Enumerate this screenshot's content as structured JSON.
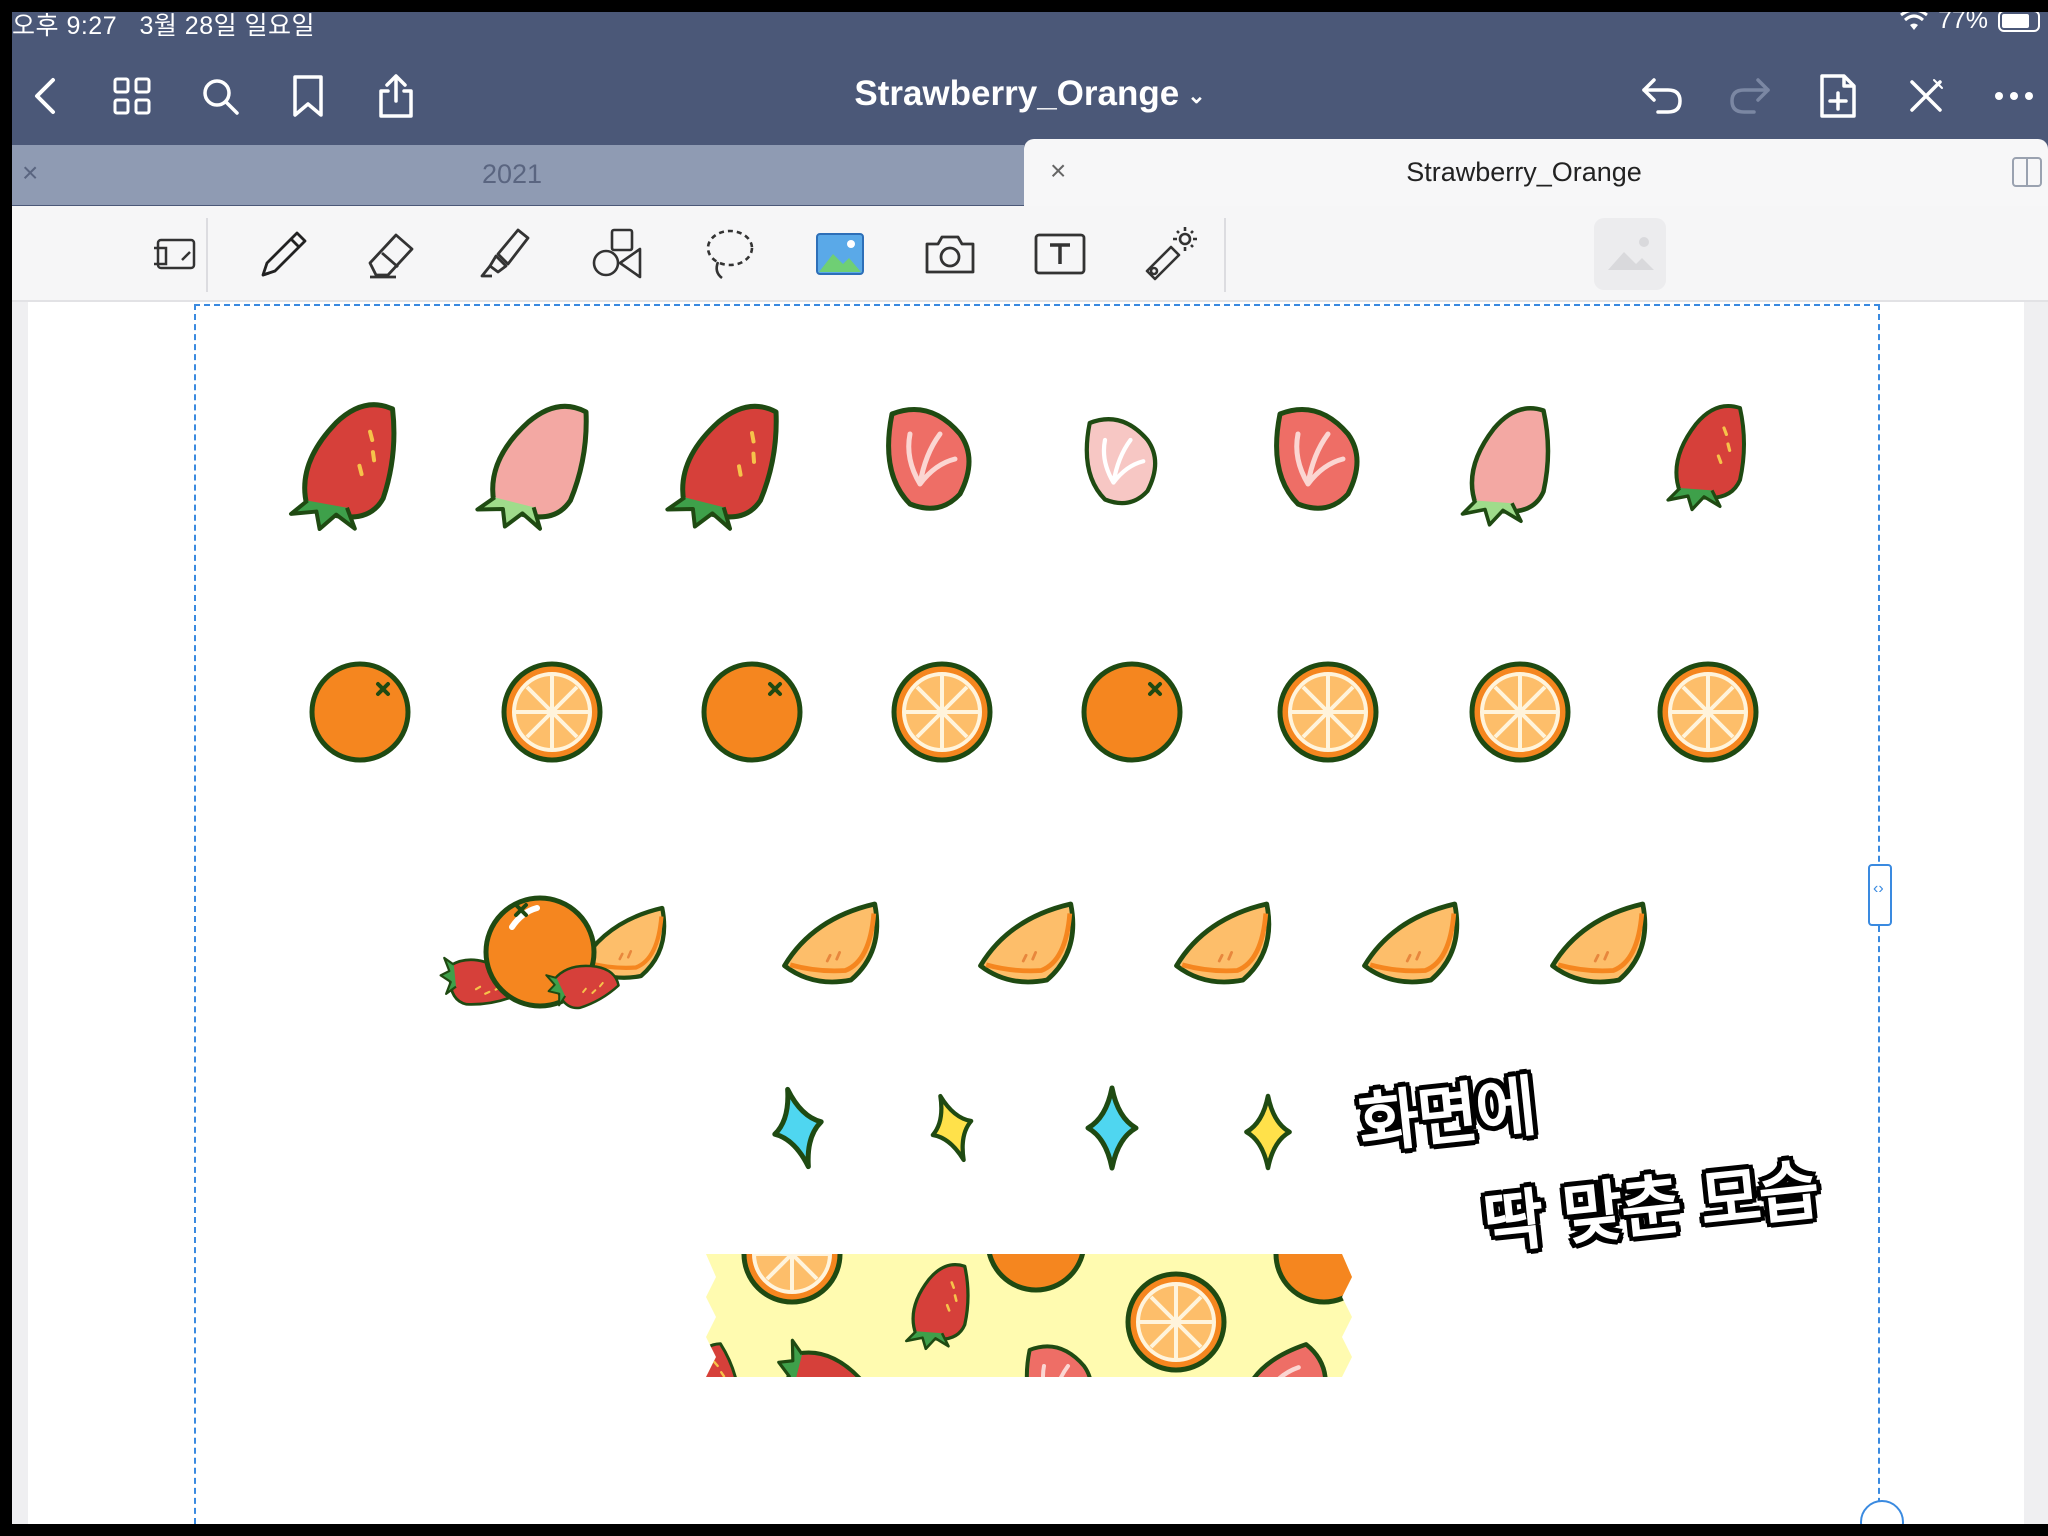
{
  "status_bar": {
    "time": "오후 9:27",
    "date": "3월 28일 일요일",
    "battery_percent": "77%",
    "wifi_icon": "wifi-icon",
    "battery_level": 0.77
  },
  "nav": {
    "title": "Strawberry_Orange",
    "title_chevron": "⌄",
    "left_icons": [
      "back-icon",
      "grid-icon",
      "search-icon",
      "bookmark-icon",
      "share-icon"
    ],
    "right_icons": [
      "undo-icon",
      "redo-icon",
      "add-page-icon",
      "close-tools-icon",
      "more-icon"
    ]
  },
  "tabs": [
    {
      "label": "2021",
      "close": "×",
      "active": false
    },
    {
      "label": "Strawberry_Orange",
      "close": "×",
      "active": true
    }
  ],
  "toolbar": {
    "tools": [
      "read-only-icon",
      "pen-icon",
      "eraser-icon",
      "highlighter-icon",
      "shapes-icon",
      "lasso-icon",
      "image-icon",
      "camera-icon",
      "text-icon",
      "laser-pointer-icon"
    ]
  },
  "canvas": {
    "handwriting_line1": "화면에",
    "handwriting_line2": "딱 맞춘 모습",
    "sticker_rows": [
      "strawberries",
      "oranges",
      "orange-slices",
      "sparkles",
      "washi-tape"
    ]
  },
  "colors": {
    "nav_bg": "#4b5878",
    "strawberry_red": "#d6403a",
    "strawberry_pink": "#f3a8a3",
    "orange": "#f5861f",
    "outline": "#1f4a12",
    "sparkle_cyan": "#4fd6f0",
    "sparkle_yellow": "#ffe14a",
    "selection_blue": "#3a8ae0"
  }
}
